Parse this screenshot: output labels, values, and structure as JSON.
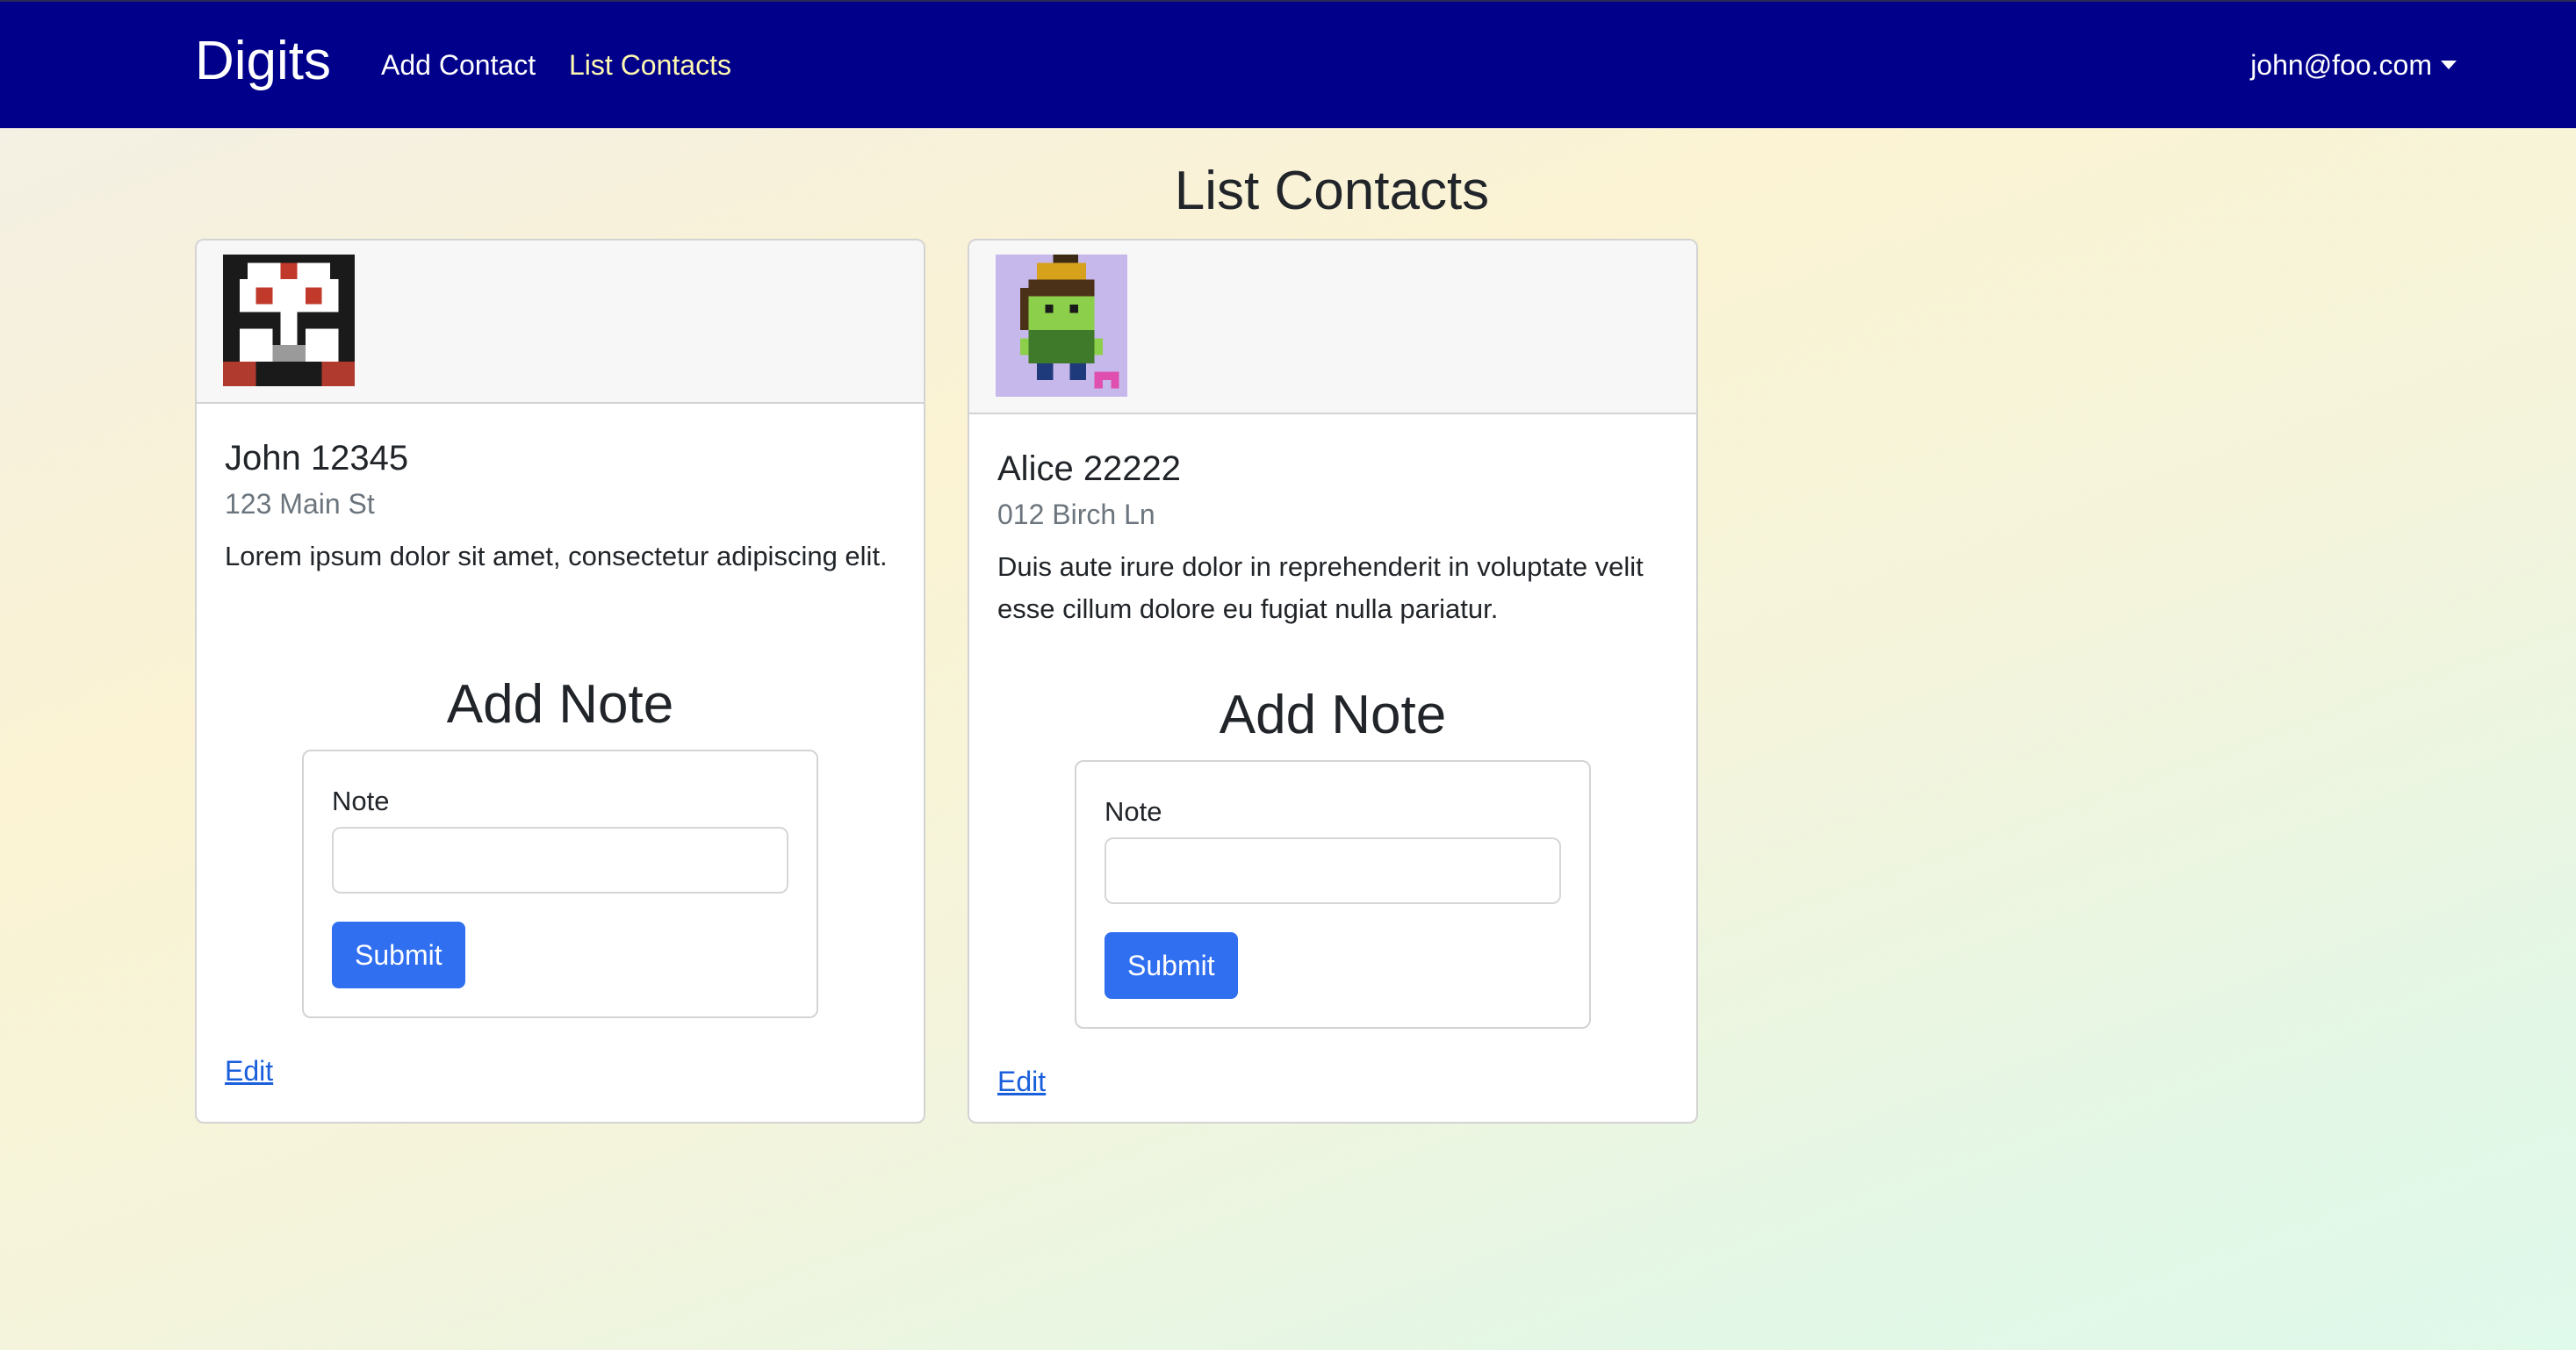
{
  "navbar": {
    "brand": "Digits",
    "links": [
      {
        "label": "Add Contact"
      },
      {
        "label": "List Contacts"
      }
    ],
    "user": "john@foo.com",
    "colors": {
      "background": "#00008b",
      "active_link": "#fff9b0"
    }
  },
  "page": {
    "title": "List Contacts"
  },
  "contacts": [
    {
      "name": "John 12345",
      "address": "123 Main St",
      "description": "Lorem ipsum dolor sit amet, consectetur adipiscing elit.",
      "avatar_icon": "pixel-trooper-avatar",
      "add_note_title": "Add Note",
      "note_label": "Note",
      "note_value": "",
      "submit_label": "Submit",
      "edit_label": "Edit"
    },
    {
      "name": "Alice 22222",
      "address": "012 Birch Ln",
      "description": "Duis aute irure dolor in reprehenderit in voluptate velit esse cillum dolore eu fugiat nulla pariatur.",
      "avatar_icon": "pixel-girl-avatar",
      "add_note_title": "Add Note",
      "note_label": "Note",
      "note_value": "",
      "submit_label": "Submit",
      "edit_label": "Edit"
    }
  ]
}
